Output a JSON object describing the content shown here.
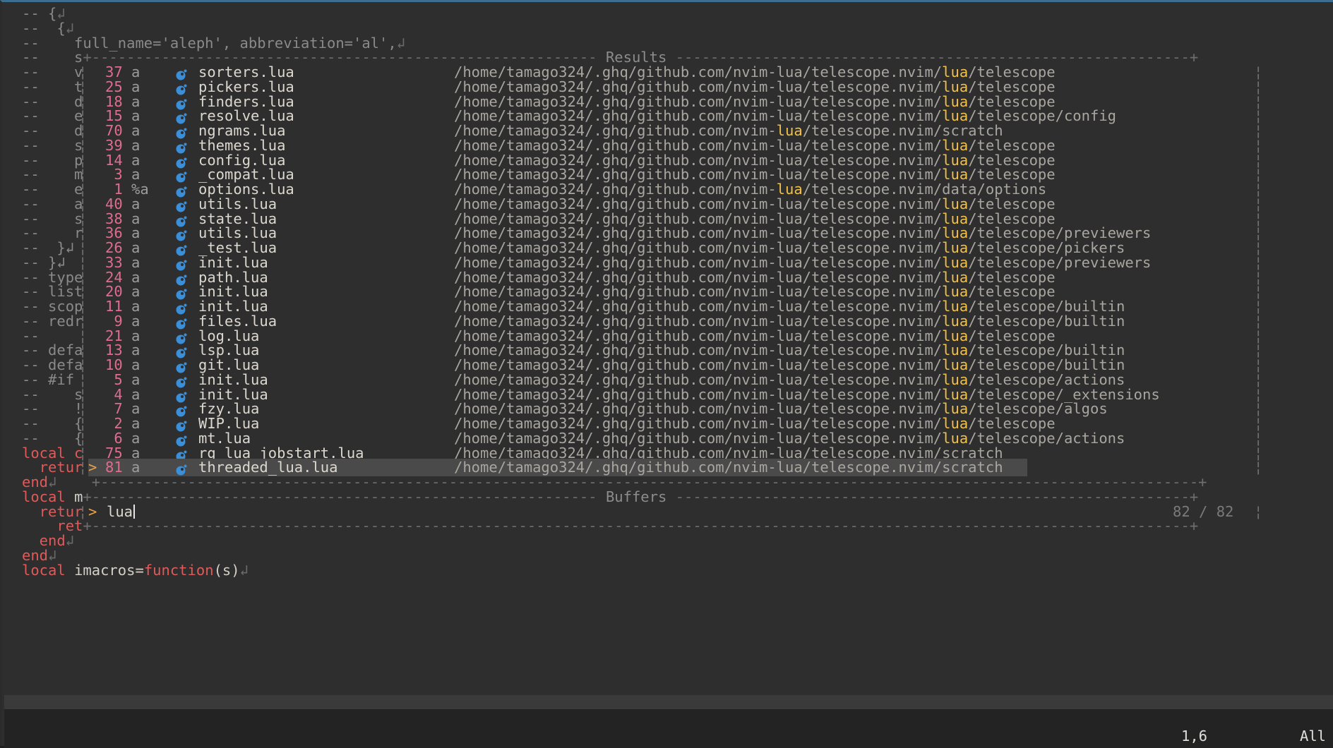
{
  "editor": {
    "code_top": [
      {
        "seg": [
          [
            "cmt",
            "-- {"
          ],
          [
            "eol",
            "↲"
          ]
        ]
      },
      {
        "seg": [
          [
            "cmt",
            "--  {"
          ],
          [
            "eol",
            "↲"
          ]
        ]
      },
      {
        "seg": [
          [
            "cmt",
            "--    full_name='aleph', abbreviation='al',"
          ],
          [
            "eol",
            "↲"
          ]
        ]
      }
    ],
    "code_bottom": [
      {
        "seg": [
          [
            "kw",
            "end"
          ],
          [
            "eol",
            "↲"
          ]
        ]
      },
      {
        "seg": [
          [
            "kw",
            "local "
          ],
          [
            "fg",
            "m"
          ]
        ]
      },
      {
        "seg": [
          [
            "kw",
            "  retur"
          ]
        ]
      },
      {
        "seg": [
          [
            "kw",
            "    ret"
          ]
        ]
      },
      {
        "seg": [
          [
            "kw",
            "  end"
          ],
          [
            "eol",
            "↲"
          ]
        ]
      },
      {
        "seg": [
          [
            "kw",
            "end"
          ],
          [
            "eol",
            "↲"
          ]
        ]
      },
      {
        "seg": [
          [
            "kw",
            "local "
          ],
          [
            "fg",
            "imacros="
          ],
          [
            "kw",
            "function"
          ],
          [
            "fg",
            "(s)"
          ],
          [
            "eol",
            "↲"
          ]
        ]
      }
    ]
  },
  "telescope": {
    "results_title": "Results",
    "prompt_title": "Buffers",
    "prompt_caret": ">",
    "query": "lua",
    "counter": "82 / 82",
    "selected_caret": ">",
    "path_prefix": "/home/tamago324/.ghq/github.com/nvim-lua/telescope.nvim/",
    "rows": [
      {
        "left": "--    s",
        "bufnr": "",
        "flag": "",
        "file": "",
        "path_a": "",
        "match": "",
        "path_b": "",
        "sep": true
      },
      {
        "left": "--    v",
        "bufnr": "37",
        "flag": "a",
        "file": "sorters.lua",
        "path_a": "/home/tamago324/.ghq/github.com/nvim-lua/telescope.nvim/",
        "match": "lua",
        "path_b": "/telescope"
      },
      {
        "left": "--    t",
        "bufnr": "25",
        "flag": "a",
        "file": "pickers.lua",
        "path_a": "/home/tamago324/.ghq/github.com/nvim-lua/telescope.nvim/",
        "match": "lua",
        "path_b": "/telescope"
      },
      {
        "left": "--    d",
        "bufnr": "18",
        "flag": "a",
        "file": "finders.lua",
        "path_a": "/home/tamago324/.ghq/github.com/nvim-lua/telescope.nvim/",
        "match": "lua",
        "path_b": "/telescope"
      },
      {
        "left": "--    e",
        "bufnr": "15",
        "flag": "a",
        "file": "resolve.lua",
        "path_a": "/home/tamago324/.ghq/github.com/nvim-lua/telescope.nvim/",
        "match": "lua",
        "path_b": "/telescope/config"
      },
      {
        "left": "--    d",
        "bufnr": "70",
        "flag": "a",
        "file": "ngrams.lua",
        "path_a": "/home/tamago324/.ghq/github.com/nvim-",
        "match": "lua",
        "path_b": "/telescope.nvim/scratch"
      },
      {
        "left": "--    s",
        "bufnr": "39",
        "flag": "a",
        "file": "themes.lua",
        "path_a": "/home/tamago324/.ghq/github.com/nvim-lua/telescope.nvim/",
        "match": "lua",
        "path_b": "/telescope"
      },
      {
        "left": "--    p",
        "bufnr": "14",
        "flag": "a",
        "file": "config.lua",
        "path_a": "/home/tamago324/.ghq/github.com/nvim-lua/telescope.nvim/",
        "match": "lua",
        "path_b": "/telescope"
      },
      {
        "left": "--    m",
        "bufnr": " 3",
        "flag": "a",
        "file": "_compat.lua",
        "path_a": "/home/tamago324/.ghq/github.com/nvim-lua/telescope.nvim/",
        "match": "lua",
        "path_b": "/telescope"
      },
      {
        "left": "--    e",
        "bufnr": " 1",
        "flag": "%a",
        "file": "options.lua",
        "path_a": "/home/tamago324/.ghq/github.com/nvim-",
        "match": "lua",
        "path_b": "/telescope.nvim/data/options"
      },
      {
        "left": "--    a",
        "bufnr": "40",
        "flag": "a",
        "file": "utils.lua",
        "path_a": "/home/tamago324/.ghq/github.com/nvim-lua/telescope.nvim/",
        "match": "lua",
        "path_b": "/telescope"
      },
      {
        "left": "--    s",
        "bufnr": "38",
        "flag": "a",
        "file": "state.lua",
        "path_a": "/home/tamago324/.ghq/github.com/nvim-lua/telescope.nvim/",
        "match": "lua",
        "path_b": "/telescope"
      },
      {
        "left": "--    r",
        "bufnr": "36",
        "flag": "a",
        "file": "utils.lua",
        "path_a": "/home/tamago324/.ghq/github.com/nvim-lua/telescope.nvim/",
        "match": "lua",
        "path_b": "/telescope/previewers"
      },
      {
        "left": "--  }↲",
        "bufnr": "26",
        "flag": "a",
        "file": "_test.lua",
        "path_a": "/home/tamago324/.ghq/github.com/nvim-lua/telescope.nvim/",
        "match": "lua",
        "path_b": "/telescope/pickers"
      },
      {
        "left": "-- }↲",
        "bufnr": "33",
        "flag": "a",
        "file": "init.lua",
        "path_a": "/home/tamago324/.ghq/github.com/nvim-lua/telescope.nvim/",
        "match": "lua",
        "path_b": "/telescope/previewers"
      },
      {
        "left": "-- type",
        "bufnr": "24",
        "flag": "a",
        "file": "path.lua",
        "path_a": "/home/tamago324/.ghq/github.com/nvim-lua/telescope.nvim/",
        "match": "lua",
        "path_b": "/telescope"
      },
      {
        "left": "-- list",
        "bufnr": "20",
        "flag": "a",
        "file": "init.lua",
        "path_a": "/home/tamago324/.ghq/github.com/nvim-lua/telescope.nvim/",
        "match": "lua",
        "path_b": "/telescope"
      },
      {
        "left": "-- scop",
        "bufnr": "11",
        "flag": "a",
        "file": "init.lua",
        "path_a": "/home/tamago324/.ghq/github.com/nvim-lua/telescope.nvim/",
        "match": "lua",
        "path_b": "/telescope/builtin"
      },
      {
        "left": "-- redr",
        "bufnr": " 9",
        "flag": "a",
        "file": "files.lua",
        "path_a": "/home/tamago324/.ghq/github.com/nvim-lua/telescope.nvim/",
        "match": "lua",
        "path_b": "/telescope/builtin"
      },
      {
        "left": "--",
        "bufnr": "21",
        "flag": "a",
        "file": "log.lua",
        "path_a": "/home/tamago324/.ghq/github.com/nvim-lua/telescope.nvim/",
        "match": "lua",
        "path_b": "/telescope"
      },
      {
        "left": "-- defa",
        "bufnr": "13",
        "flag": "a",
        "file": "lsp.lua",
        "path_a": "/home/tamago324/.ghq/github.com/nvim-lua/telescope.nvim/",
        "match": "lua",
        "path_b": "/telescope/builtin"
      },
      {
        "left": "-- defa",
        "bufnr": "10",
        "flag": "a",
        "file": "git.lua",
        "path_a": "/home/tamago324/.ghq/github.com/nvim-lua/telescope.nvim/",
        "match": "lua",
        "path_b": "/telescope/builtin"
      },
      {
        "left": "-- #if",
        "bufnr": " 5",
        "flag": "a",
        "file": "init.lua",
        "path_a": "/home/tamago324/.ghq/github.com/nvim-lua/telescope.nvim/",
        "match": "lua",
        "path_b": "/telescope/actions"
      },
      {
        "left": "--    s",
        "bufnr": " 4",
        "flag": "a",
        "file": "init.lua",
        "path_a": "/home/tamago324/.ghq/github.com/nvim-lua/telescope.nvim/",
        "match": "lua",
        "path_b": "/telescope/_extensions"
      },
      {
        "left": "--    !",
        "bufnr": " 7",
        "flag": "a",
        "file": "fzy.lua",
        "path_a": "/home/tamago324/.ghq/github.com/nvim-lua/telescope.nvim/",
        "match": "lua",
        "path_b": "/telescope/algos"
      },
      {
        "left": "--    {",
        "bufnr": " 2",
        "flag": "a",
        "file": "WIP.lua",
        "path_a": "/home/tamago324/.ghq/github.com/nvim-lua/telescope.nvim/",
        "match": "lua",
        "path_b": "/telescope"
      },
      {
        "left": "--    {",
        "bufnr": " 6",
        "flag": "a",
        "file": "mt.lua",
        "path_a": "/home/tamago324/.ghq/github.com/nvim-lua/telescope.nvim/",
        "match": "lua",
        "path_b": "/telescope/actions"
      },
      {
        "left": "local c",
        "bufnr": "75",
        "flag": "a",
        "file": "rg_lua_jobstart.lua",
        "path_a": "/home/tamago324/.ghq/github.com/nvim-lua/telescope.nvim/scratch",
        "match": "",
        "path_b": ""
      },
      {
        "left": "  retur",
        "bufnr": "81",
        "flag": "a",
        "file": "threaded_lua.lua",
        "path_a": "/home/tamago324/.ghq/github.com/nvim-lua/telescope.nvim/scratch",
        "match": "",
        "path_b": "",
        "selected": true
      }
    ]
  },
  "status": {
    "ruler": "1,6",
    "position": "All"
  },
  "colors": {
    "match": "#f2c046",
    "bufnr": "#e06c90",
    "keyword": "#e05a5a",
    "selection": "#4a4a4a"
  }
}
